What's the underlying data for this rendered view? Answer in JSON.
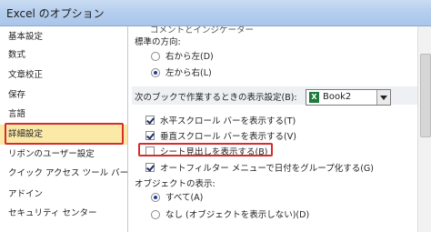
{
  "window": {
    "title": "Excel のオプション"
  },
  "sidebar": {
    "items": [
      {
        "label": "基本設定"
      },
      {
        "label": "数式"
      },
      {
        "label": "文章校正"
      },
      {
        "label": "保存"
      },
      {
        "label": "言語"
      },
      {
        "label": "詳細設定"
      },
      {
        "label": "リボンのユーザー設定"
      },
      {
        "label": "クイック アクセス ツール バー"
      },
      {
        "label": "アドイン"
      },
      {
        "label": "セキュリティ センター"
      }
    ],
    "selected": "詳細設定"
  },
  "main": {
    "partial_top": "コメントとインジケーター",
    "direction": {
      "label": "標準の方向:",
      "option_rtl": "右から左(D)",
      "option_ltr": "左から右(L)",
      "selected": "option_ltr"
    },
    "section": {
      "label": "次のブックで作業するときの表示設定(B):",
      "book_value": "Book2",
      "excel_icon_glyph": "X"
    },
    "checkboxes": [
      {
        "label": "水平スクロール バーを表示する(T)",
        "checked": true
      },
      {
        "label": "垂直スクロール バーを表示する(V)",
        "checked": true
      },
      {
        "label": "シート見出しを表示する(B)",
        "checked": false
      },
      {
        "label": "オートフィルター メニューで日付をグループ化する(G)",
        "checked": true
      }
    ],
    "objects": {
      "label": "オブジェクトの表示:",
      "option_all": "すべて(A)",
      "option_none": "なし (オブジェクトを表示しない)(D)",
      "selected": "option_all"
    }
  },
  "colors": {
    "highlight_red": "#d92b2b",
    "selected_bg": "#fbe9a8",
    "titlebar": "#b7cfee"
  }
}
